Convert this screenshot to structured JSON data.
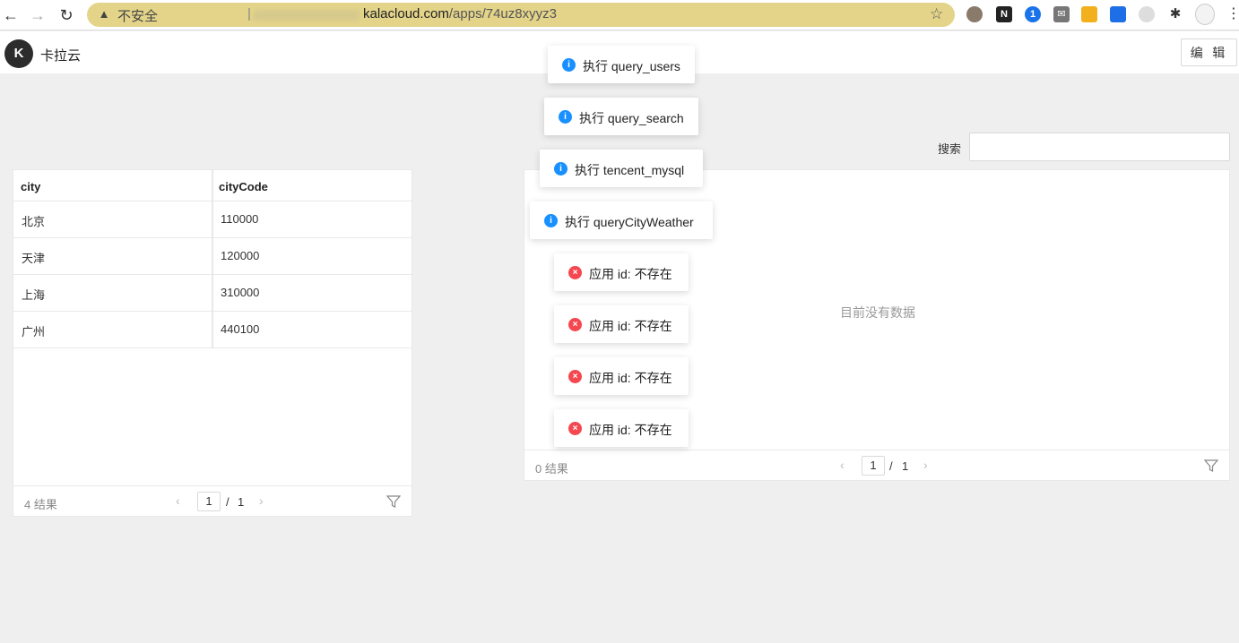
{
  "browser": {
    "insecure_label": "不安全",
    "url_separator": "|",
    "url_host": "kalacloud.com",
    "url_path": "/apps/74uz8xyyz3"
  },
  "app": {
    "brand_name": "卡拉云",
    "edit_label": "编 辑"
  },
  "left_table": {
    "columns": [
      "city",
      "cityCode"
    ],
    "rows": [
      {
        "city": "北京",
        "cityCode": "110000"
      },
      {
        "city": "天津",
        "cityCode": "120000"
      },
      {
        "city": "上海",
        "cityCode": "310000"
      },
      {
        "city": "广州",
        "cityCode": "440100"
      }
    ],
    "count_text": "4 结果",
    "page_current": "1",
    "page_sep": "/",
    "page_total": "1"
  },
  "search": {
    "label": "搜索",
    "value": ""
  },
  "right_table": {
    "empty_text": "目前没有数据",
    "count_text": "0 结果",
    "page_current": "1",
    "page_sep": "/",
    "page_total": "1"
  },
  "toasts": [
    {
      "type": "info",
      "text": "执行 query_users"
    },
    {
      "type": "info",
      "text": "执行 query_search"
    },
    {
      "type": "info",
      "text": "执行 tencent_mysql"
    },
    {
      "type": "info",
      "text": "执行 queryCityWeather"
    },
    {
      "type": "error",
      "text": "应用 id: 不存在"
    },
    {
      "type": "error",
      "text": "应用 id: 不存在"
    },
    {
      "type": "error",
      "text": "应用 id: 不存在"
    },
    {
      "type": "error",
      "text": "应用 id: 不存在"
    }
  ],
  "colors": {
    "info": "#1890ff",
    "error": "#f5474f",
    "urlbar": "#e3d48a"
  }
}
